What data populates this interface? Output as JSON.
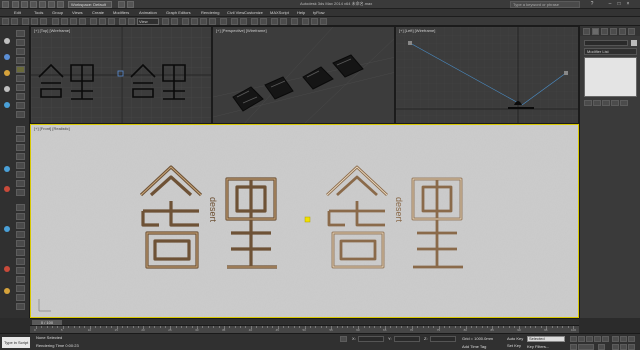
{
  "titlebar": {
    "workspace": "Workspace: Default",
    "window_title": "Autodesk 3ds Max 2014 x64    未命名.max",
    "search_placeholder": "Type a keyword or phrase"
  },
  "menu": [
    "Edit",
    "Tools",
    "Group",
    "Views",
    "Create",
    "Modifiers",
    "Animation",
    "Graph Editors",
    "Rendering",
    "Civil View",
    "Customize",
    "MAXScript",
    "Help",
    "tyFlow"
  ],
  "toolbar": {
    "selection_filter": "View"
  },
  "viewports": {
    "top": "[+] [Top] [Wireframe]",
    "perspective": "[+] [Perspective] [Wireframe]",
    "left": "[+] [Left] [Wireframe]",
    "front": "[+] [Front] [Realistic]"
  },
  "artwork": {
    "subtitle_vertical": "desert"
  },
  "command_panel": {
    "modifier_list": "Modifier List"
  },
  "timeline": {
    "frame": "0 / 100",
    "ticks": [
      "0",
      "5",
      "10",
      "15",
      "20",
      "25",
      "30",
      "35",
      "40",
      "45",
      "50",
      "55",
      "60",
      "65",
      "70",
      "75",
      "80",
      "85",
      "90",
      "95",
      "100"
    ]
  },
  "status": {
    "maxscript": "Type in Script",
    "selection": "None Selected",
    "render_time": "Rendering Time  0:00:23",
    "x_label": "X:",
    "y_label": "Y:",
    "z_label": "Z:",
    "grid": "Grid = 1000.0mm",
    "add_time_tag": "Add Time Tag",
    "auto_key": "Auto Key",
    "set_key": "Set Key",
    "selected": "Selected",
    "key_filters": "Key Filters..."
  },
  "colors": {
    "active_viewport_border": "#d8c800",
    "glyph_outline": "#7a5c3a",
    "viewport_bg_front": "#cfcfcf"
  }
}
